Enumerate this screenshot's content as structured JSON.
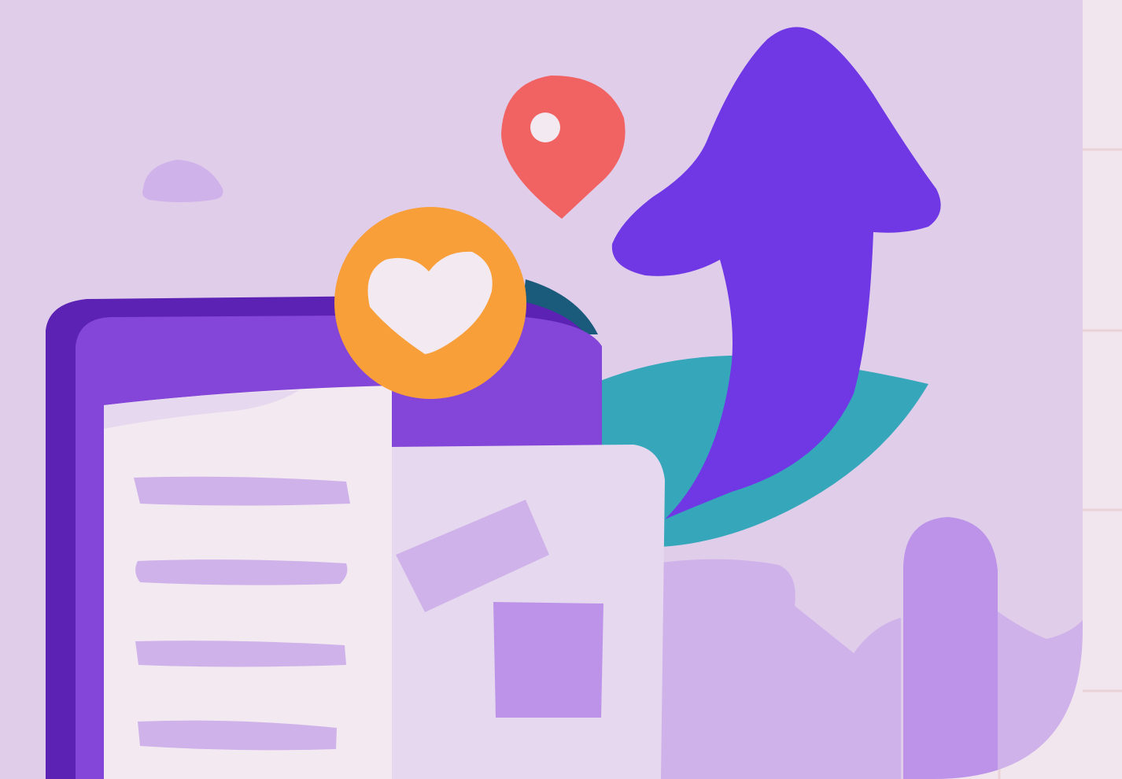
{
  "scene": {
    "colors": {
      "background_panel": "#e0cdea",
      "page_margin": "#f2e6ee",
      "grid_line": "#e9d3d7",
      "device_dark": "#5c22b4",
      "device_body": "#8446d8",
      "paper_white": "#f2e9f1",
      "paper_lavender": "#e6d8ee",
      "line_accent": "#d0b2ea",
      "block_accent": "#bc93e9",
      "arrow_purple": "#7038e5",
      "leaf_teal": "#36a7bb",
      "dark_teal": "#1a5a7b",
      "pin_red": "#f16363",
      "heart_orange": "#f89f3a"
    },
    "icons": {
      "arrow": "up-arrow-icon",
      "pin": "location-pin-icon",
      "heart": "heart-icon",
      "leaf": "leaf-icon"
    }
  }
}
